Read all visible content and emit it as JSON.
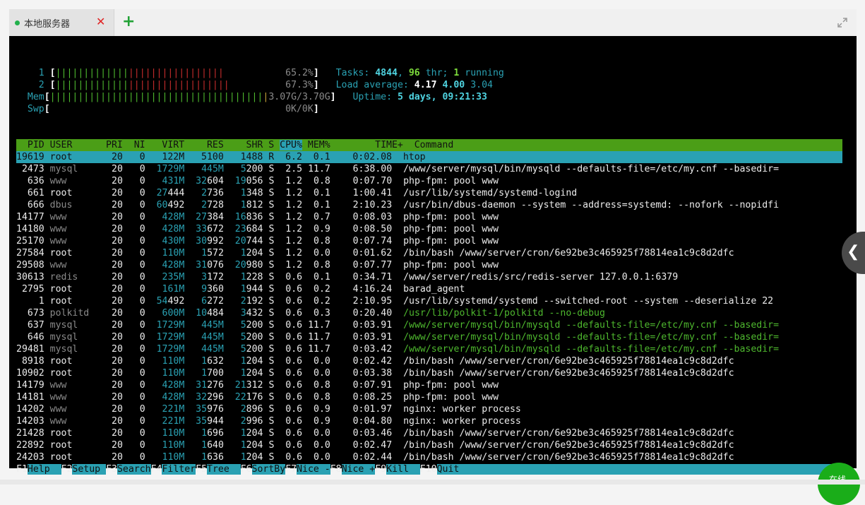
{
  "tab": {
    "title": "本地服务器",
    "close_icon": "close-icon",
    "add_icon": "plus-icon"
  },
  "expand_icon": "expand-icon",
  "meters": {
    "cpu1": {
      "label": "1",
      "value": "65.2%",
      "percent": 65.2
    },
    "cpu2": {
      "label": "2",
      "value": "67.3%",
      "percent": 67.3
    },
    "mem": {
      "label": "Mem",
      "used": "3.07G",
      "total": "3.70G",
      "percent": 83
    },
    "swp": {
      "label": "Swp",
      "value": "0K/0K"
    }
  },
  "stats": {
    "tasks_label": "Tasks:",
    "tasks": "4844",
    "threads": "96",
    "thr_label": "thr;",
    "running": "1",
    "running_label": "running",
    "load_label": "Load average:",
    "load1": "4.17",
    "load5": "4.00",
    "load15": "3.04",
    "uptime_label": "Uptime:",
    "uptime": "5 days, 09:21:33"
  },
  "columns": [
    "PID",
    "USER",
    "PRI",
    "NI",
    "VIRT",
    "RES",
    "SHR",
    "S",
    "CPU%",
    "MEM%",
    "TIME+",
    "Command"
  ],
  "processes": [
    {
      "pid": "19619",
      "user": "root",
      "pri": "20",
      "ni": "0",
      "virt": "122M",
      "res": "5100",
      "shr": "1488",
      "s": "R",
      "cpu": "6.2",
      "mem": "0.1",
      "time": "0:02.08",
      "cmd": "htop",
      "selected": true
    },
    {
      "pid": "2473",
      "user": "mysql",
      "pri": "20",
      "ni": "0",
      "virt": "1729M",
      "res": "445M",
      "shr": "5200",
      "s": "S",
      "cpu": "2.5",
      "mem": "11.7",
      "time": "6:38.00",
      "cmd": "/www/server/mysql/bin/mysqld --defaults-file=/etc/my.cnf --basedir="
    },
    {
      "pid": "636",
      "user": "www",
      "pri": "20",
      "ni": "0",
      "virt": "431M",
      "res": "32604",
      "shr": "19056",
      "s": "S",
      "cpu": "1.2",
      "mem": "0.8",
      "time": "0:07.70",
      "cmd": "php-fpm: pool www"
    },
    {
      "pid": "661",
      "user": "root",
      "pri": "20",
      "ni": "0",
      "virt": "27444",
      "res": "2736",
      "shr": "1348",
      "s": "S",
      "cpu": "1.2",
      "mem": "0.1",
      "time": "1:00.41",
      "cmd": "/usr/lib/systemd/systemd-logind"
    },
    {
      "pid": "666",
      "user": "dbus",
      "pri": "20",
      "ni": "0",
      "virt": "60492",
      "res": "2728",
      "shr": "1812",
      "s": "S",
      "cpu": "1.2",
      "mem": "0.1",
      "time": "2:10.23",
      "cmd": "/usr/bin/dbus-daemon --system --address=systemd: --nofork --nopidfi"
    },
    {
      "pid": "14177",
      "user": "www",
      "pri": "20",
      "ni": "0",
      "virt": "428M",
      "res": "27384",
      "shr": "16836",
      "s": "S",
      "cpu": "1.2",
      "mem": "0.7",
      "time": "0:08.03",
      "cmd": "php-fpm: pool www"
    },
    {
      "pid": "14180",
      "user": "www",
      "pri": "20",
      "ni": "0",
      "virt": "428M",
      "res": "33672",
      "shr": "23684",
      "s": "S",
      "cpu": "1.2",
      "mem": "0.9",
      "time": "0:08.50",
      "cmd": "php-fpm: pool www"
    },
    {
      "pid": "25170",
      "user": "www",
      "pri": "20",
      "ni": "0",
      "virt": "430M",
      "res": "30992",
      "shr": "20744",
      "s": "S",
      "cpu": "1.2",
      "mem": "0.8",
      "time": "0:07.74",
      "cmd": "php-fpm: pool www"
    },
    {
      "pid": "27584",
      "user": "root",
      "pri": "20",
      "ni": "0",
      "virt": "110M",
      "res": "1572",
      "shr": "1204",
      "s": "S",
      "cpu": "1.2",
      "mem": "0.0",
      "time": "0:01.62",
      "cmd": "/bin/bash /www/server/cron/6e92be3c465925f78814ea1c9c8d2dfc"
    },
    {
      "pid": "29508",
      "user": "www",
      "pri": "20",
      "ni": "0",
      "virt": "428M",
      "res": "31076",
      "shr": "20980",
      "s": "S",
      "cpu": "1.2",
      "mem": "0.8",
      "time": "0:07.77",
      "cmd": "php-fpm: pool www"
    },
    {
      "pid": "30613",
      "user": "redis",
      "pri": "20",
      "ni": "0",
      "virt": "235M",
      "res": "3172",
      "shr": "1228",
      "s": "S",
      "cpu": "0.6",
      "mem": "0.1",
      "time": "0:34.71",
      "cmd": "/www/server/redis/src/redis-server 127.0.0.1:6379"
    },
    {
      "pid": "2795",
      "user": "root",
      "pri": "20",
      "ni": "0",
      "virt": "161M",
      "res": "9360",
      "shr": "1944",
      "s": "S",
      "cpu": "0.6",
      "mem": "0.2",
      "time": "4:16.24",
      "cmd": "barad_agent"
    },
    {
      "pid": "1",
      "user": "root",
      "pri": "20",
      "ni": "0",
      "virt": "54492",
      "res": "6272",
      "shr": "2192",
      "s": "S",
      "cpu": "0.6",
      "mem": "0.2",
      "time": "2:10.95",
      "cmd": "/usr/lib/systemd/systemd --switched-root --system --deserialize 22"
    },
    {
      "pid": "673",
      "user": "polkitd",
      "pri": "20",
      "ni": "0",
      "virt": "600M",
      "res": "10484",
      "shr": "3432",
      "s": "S",
      "cpu": "0.6",
      "mem": "0.3",
      "time": "0:20.40",
      "cmd": "/usr/lib/polkit-1/polkitd --no-debug",
      "thread": true
    },
    {
      "pid": "637",
      "user": "mysql",
      "pri": "20",
      "ni": "0",
      "virt": "1729M",
      "res": "445M",
      "shr": "5200",
      "s": "S",
      "cpu": "0.6",
      "mem": "11.7",
      "time": "0:03.91",
      "cmd": "/www/server/mysql/bin/mysqld --defaults-file=/etc/my.cnf --basedir=",
      "thread": true
    },
    {
      "pid": "646",
      "user": "mysql",
      "pri": "20",
      "ni": "0",
      "virt": "1729M",
      "res": "445M",
      "shr": "5200",
      "s": "S",
      "cpu": "0.6",
      "mem": "11.7",
      "time": "0:03.91",
      "cmd": "/www/server/mysql/bin/mysqld --defaults-file=/etc/my.cnf --basedir=",
      "thread": true
    },
    {
      "pid": "29481",
      "user": "mysql",
      "pri": "20",
      "ni": "0",
      "virt": "1729M",
      "res": "445M",
      "shr": "5200",
      "s": "S",
      "cpu": "0.6",
      "mem": "11.7",
      "time": "0:03.42",
      "cmd": "/www/server/mysql/bin/mysqld --defaults-file=/etc/my.cnf --basedir=",
      "thread": true
    },
    {
      "pid": "8918",
      "user": "root",
      "pri": "20",
      "ni": "0",
      "virt": "110M",
      "res": "1632",
      "shr": "1204",
      "s": "S",
      "cpu": "0.6",
      "mem": "0.0",
      "time": "0:02.42",
      "cmd": "/bin/bash /www/server/cron/6e92be3c465925f78814ea1c9c8d2dfc"
    },
    {
      "pid": "10902",
      "user": "root",
      "pri": "20",
      "ni": "0",
      "virt": "110M",
      "res": "1700",
      "shr": "1204",
      "s": "S",
      "cpu": "0.6",
      "mem": "0.0",
      "time": "0:03.38",
      "cmd": "/bin/bash /www/server/cron/6e92be3c465925f78814ea1c9c8d2dfc"
    },
    {
      "pid": "14179",
      "user": "www",
      "pri": "20",
      "ni": "0",
      "virt": "428M",
      "res": "31276",
      "shr": "21312",
      "s": "S",
      "cpu": "0.6",
      "mem": "0.8",
      "time": "0:07.91",
      "cmd": "php-fpm: pool www"
    },
    {
      "pid": "14181",
      "user": "www",
      "pri": "20",
      "ni": "0",
      "virt": "428M",
      "res": "32296",
      "shr": "22176",
      "s": "S",
      "cpu": "0.6",
      "mem": "0.8",
      "time": "0:08.25",
      "cmd": "php-fpm: pool www"
    },
    {
      "pid": "14202",
      "user": "www",
      "pri": "20",
      "ni": "0",
      "virt": "221M",
      "res": "35976",
      "shr": "2896",
      "s": "S",
      "cpu": "0.6",
      "mem": "0.9",
      "time": "0:01.97",
      "cmd": "nginx: worker process"
    },
    {
      "pid": "14203",
      "user": "www",
      "pri": "20",
      "ni": "0",
      "virt": "221M",
      "res": "35944",
      "shr": "2996",
      "s": "S",
      "cpu": "0.6",
      "mem": "0.9",
      "time": "0:04.80",
      "cmd": "nginx: worker process"
    },
    {
      "pid": "21428",
      "user": "root",
      "pri": "20",
      "ni": "0",
      "virt": "110M",
      "res": "1696",
      "shr": "1204",
      "s": "S",
      "cpu": "0.6",
      "mem": "0.0",
      "time": "0:03.46",
      "cmd": "/bin/bash /www/server/cron/6e92be3c465925f78814ea1c9c8d2dfc"
    },
    {
      "pid": "22892",
      "user": "root",
      "pri": "20",
      "ni": "0",
      "virt": "110M",
      "res": "1640",
      "shr": "1204",
      "s": "S",
      "cpu": "0.6",
      "mem": "0.0",
      "time": "0:02.47",
      "cmd": "/bin/bash /www/server/cron/6e92be3c465925f78814ea1c9c8d2dfc"
    },
    {
      "pid": "24203",
      "user": "root",
      "pri": "20",
      "ni": "0",
      "virt": "110M",
      "res": "1636",
      "shr": "1204",
      "s": "S",
      "cpu": "0.6",
      "mem": "0.0",
      "time": "0:02.44",
      "cmd": "/bin/bash /www/server/cron/6e92be3c465925f78814ea1c9c8d2dfc"
    }
  ],
  "fkeys": [
    {
      "key": "F1",
      "label": "Help  "
    },
    {
      "key": "F2",
      "label": "Setup "
    },
    {
      "key": "F3",
      "label": "Search"
    },
    {
      "key": "F4",
      "label": "Filter"
    },
    {
      "key": "F5",
      "label": "Tree  "
    },
    {
      "key": "F6",
      "label": "SortBy"
    },
    {
      "key": "F7",
      "label": "Nice -"
    },
    {
      "key": "F8",
      "label": "Nice +"
    },
    {
      "key": "F9",
      "label": "Kill  "
    },
    {
      "key": "F10",
      "label": "Quit"
    }
  ],
  "side_toggle_icon": "chevron-left-icon",
  "online_badge": "在线",
  "colors": {
    "accent_cyan": "#2aa1b3",
    "header_green": "#4b9e17",
    "bar_green": "#4eb82e",
    "bar_red": "#c62c2c",
    "terminal_bg": "#000000"
  }
}
